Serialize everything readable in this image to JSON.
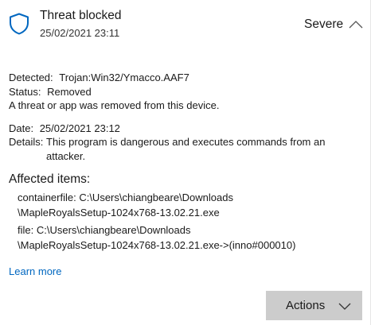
{
  "header": {
    "title": "Threat blocked",
    "timestamp": "25/02/2021 23:11",
    "severity": "Severe",
    "shield_icon": "shield-icon",
    "collapse_icon": "chevron-up-icon",
    "accent_color": "#0067c0"
  },
  "detected": {
    "label": "Detected:",
    "value": "Trojan:Win32/Ymacco.AAF7"
  },
  "status": {
    "label": "Status:",
    "value": "Removed"
  },
  "status_message": "A threat or app was removed from this device.",
  "date": {
    "label": "Date:",
    "value": "25/02/2021 23:12"
  },
  "details": {
    "label": "Details:",
    "value": "This program is dangerous and executes commands from an attacker."
  },
  "affected": {
    "heading": "Affected items:",
    "items": [
      {
        "line1": "containerfile: C:\\Users\\chiangbeare\\Downloads",
        "line2": "\\MapleRoyalsSetup-1024x768-13.02.21.exe"
      },
      {
        "line1": "file: C:\\Users\\chiangbeare\\Downloads",
        "line2": "\\MapleRoyalsSetup-1024x768-13.02.21.exe->(inno#000010)"
      }
    ]
  },
  "learn_more": "Learn more",
  "actions": {
    "label": "Actions",
    "icon": "chevron-down-icon"
  }
}
